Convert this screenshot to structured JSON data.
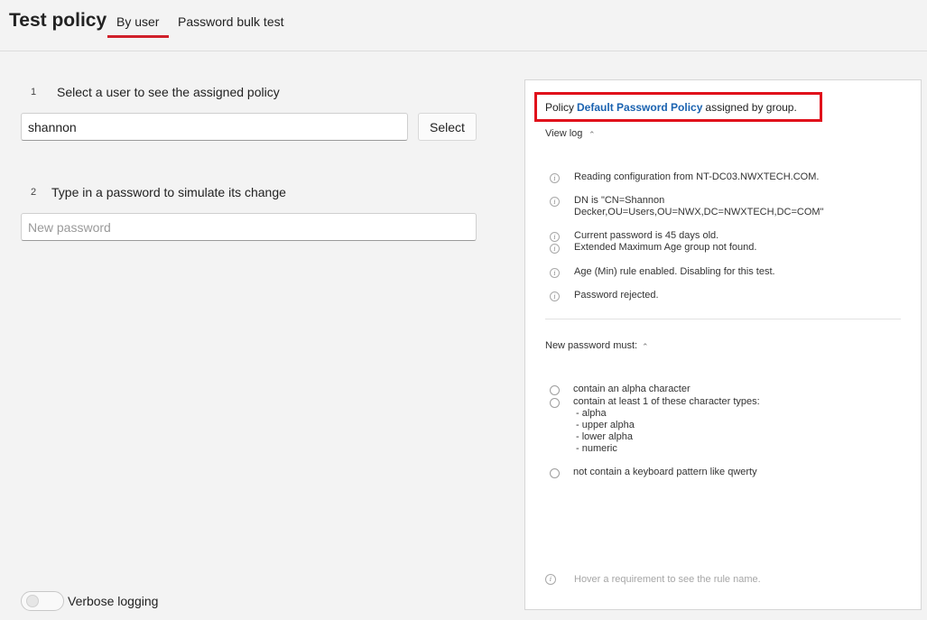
{
  "header": {
    "title": "Test policy",
    "tabs": [
      {
        "label": "By user",
        "active": true
      },
      {
        "label": "Password bulk test",
        "active": false
      }
    ],
    "accent_color": "#d0202a"
  },
  "step1": {
    "number": "1",
    "label": "Select a user to see the assigned policy",
    "input_value": "shannon",
    "button_label": "Select"
  },
  "step2": {
    "number": "2",
    "label": "Type in a password to simulate its change",
    "placeholder": "New password"
  },
  "verbose": {
    "label": "Verbose logging",
    "enabled": false
  },
  "panel": {
    "policy_prefix": "Policy",
    "policy_name": "Default Password Policy",
    "policy_suffix": "assigned by group.",
    "view_log_label": "View log",
    "log": [
      "Reading configuration from NT-DC03.NWXTECH.COM.",
      "DN is \"CN=Shannon",
      "Decker,OU=Users,OU=NWX,DC=NWXTECH,DC=COM\"",
      "Current password is 45 days old.",
      "Extended Maximum Age group not found.",
      "Age (Min) rule enabled. Disabling for this test.",
      "Password rejected."
    ],
    "requirements_label": "New password must:",
    "requirements": [
      "contain an alpha character",
      "contain at least 1 of these character types:",
      "- alpha",
      "- upper alpha",
      "- lower alpha",
      "- numeric",
      "not contain a keyboard pattern like qwerty"
    ],
    "hint": "Hover a requirement to see the rule name.",
    "highlight_color": "#e0101b",
    "link_color": "#1a62b0"
  }
}
